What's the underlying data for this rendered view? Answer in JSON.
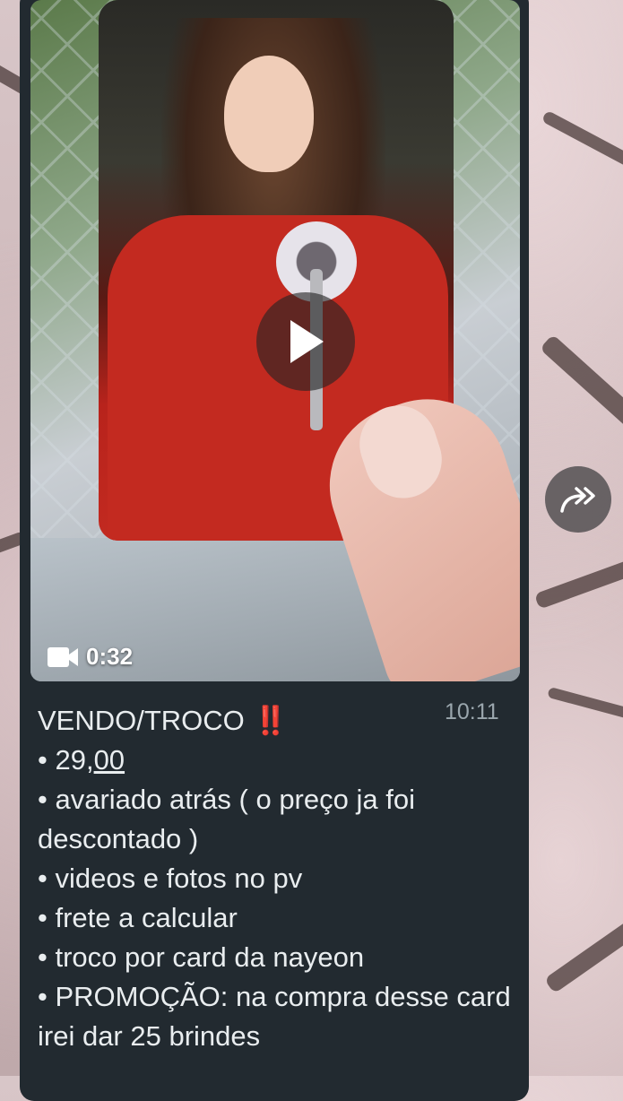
{
  "video": {
    "duration": "0:32",
    "play_icon": "play-icon",
    "camera_icon": "video-camera-icon"
  },
  "message": {
    "time": "10:11",
    "title": "VENDO/TROCO",
    "emphasis": "‼️",
    "price_prefix": "• 29,",
    "price_cents": "00",
    "lines": [
      "• avariado atrás ( o preço ja foi descontado )",
      "• videos e fotos no pv",
      "• frete a calcular",
      "• troco por card da nayeon",
      "• PROMOÇÃO: na compra desse card irei dar 25 brindes"
    ]
  },
  "forward_icon": "forward-icon",
  "colors": {
    "bubble": "#222a30",
    "text": "#e9edef",
    "timestamp": "#9aa6ad",
    "emphasis": "#e0242a"
  }
}
